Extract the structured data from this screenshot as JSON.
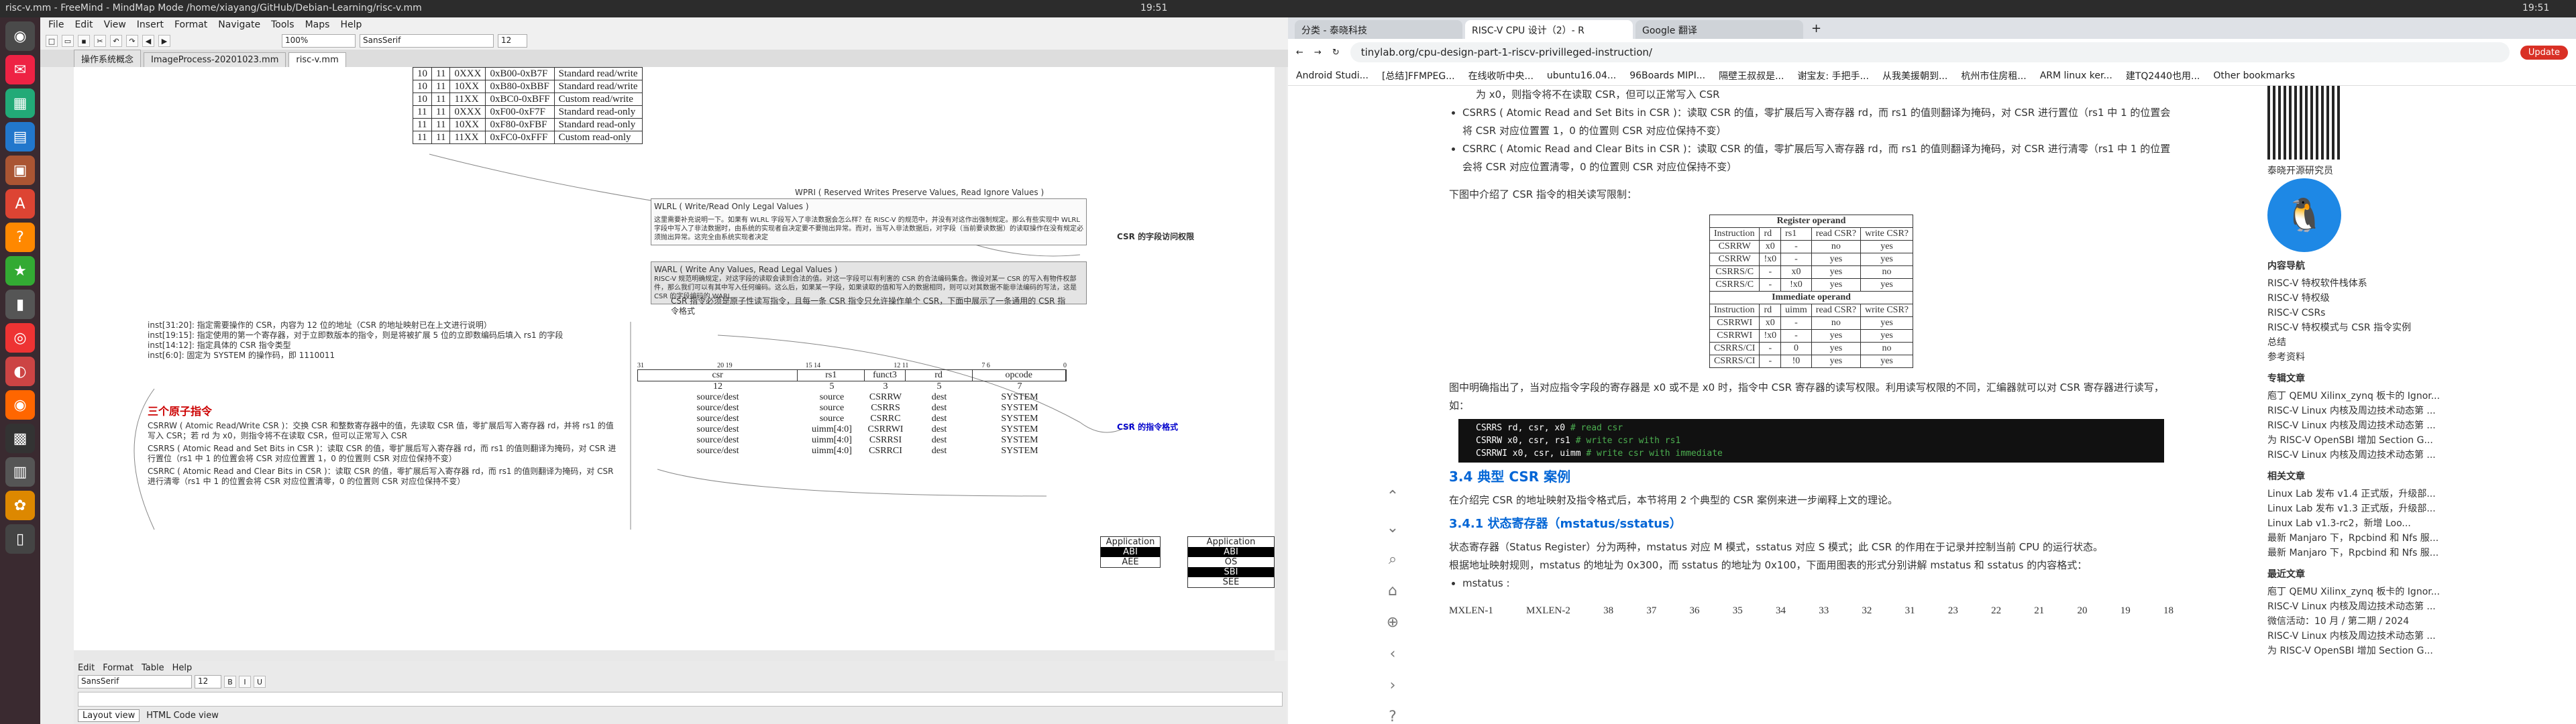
{
  "left_window": {
    "title": "risc-v.mm - FreeMind - MindMap Mode /home/xiayang/GitHub/Debian-Learning/risc-v.mm",
    "menu": [
      "File",
      "Edit",
      "View",
      "Insert",
      "Format",
      "Navigate",
      "Tools",
      "Maps",
      "Help"
    ],
    "zoom": "100%",
    "font": "SansSerif",
    "font_size": "12",
    "tabs": [
      "操作系统概念",
      "ImageProcess-20201023.mm",
      "risc-v.mm"
    ],
    "csr_addr_table": [
      [
        "10",
        "11",
        "0XXX",
        "0xB00-0xB7F",
        "Standard read/write"
      ],
      [
        "10",
        "11",
        "10XX",
        "0xB80-0xBBF",
        "Standard read/write"
      ],
      [
        "10",
        "11",
        "11XX",
        "0xBC0-0xBFF",
        "Custom read/write"
      ],
      [
        "11",
        "11",
        "0XXX",
        "0xF00-0xF7F",
        "Standard read-only"
      ],
      [
        "11",
        "11",
        "10XX",
        "0xF80-0xFBF",
        "Standard read-only"
      ],
      [
        "11",
        "11",
        "11XX",
        "0xFC0-0xFFF",
        "Custom read-only"
      ]
    ],
    "wpri": "WPRI ( Reserved Writes Preserve Values, Read Ignore Values )",
    "wlrl_title": "WLRL ( Write/Read Only Legal Values )",
    "wlrl_text": "这里需要补充说明一下。如果有 WLRL 字段写入了非法数据会怎么样？在 RISC-V 的规范中，并没有对这作出强制规定。那么有些实现中 WLRL 字段中写入了非法数据时，由系统的实现者自决定要不要抛出异常。而对，当写入非法数据后，对字段（当前要读数据）的读取操作在没有规定必须抛出异常。这完全由系统实现者决定",
    "warl_title": "WARL ( Write Any Values, Read Legal Values )",
    "warl_text": "RISC-V 规范明确规定，对这字段的读取会读到合法的值。对这一字段可以有利害的 CSR 的合法编码集合。微设对某一 CSR 的写入有物件权部件，那么我们可以有其中写入任何编码。这么后，如果某一字段，如果读取的值和写入的数据相同，则可以对其数据不能非法编码的写法，这是 CSR 的字段编码的 WARL",
    "csr_access_label": "CSR 的字段访问权限",
    "csr_intro": "CSR 指令必须是原子性读写指令，且每一条 CSR 指令只允许操作单个 CSR，下面中展示了一条通用的 CSR 指令格式",
    "inst_notes": [
      "inst[31:20]: 指定需要操作的 CSR，内容为 12 位的地址（CSR 的地址映射已在上文进行说明）",
      "inst[19:15]: 指定使用的第一个寄存器，对于立即数版本的指令，则是将被扩展 5 位的立即数编码后填入 rs1 的字段",
      "inst[14:12]: 指定具体的 CSR 指令类型",
      "inst[6:0]: 固定为 SYSTEM 的操作码，即 1110011"
    ],
    "fmt_bits": [
      "31",
      "20 19",
      "15 14",
      "12 11",
      "7 6",
      "0"
    ],
    "fmt_fields": [
      "csr",
      "rs1",
      "funct3",
      "rd",
      "opcode"
    ],
    "fmt_widths": [
      "12",
      "5",
      "3",
      "5",
      "7"
    ],
    "fmt_rows": [
      [
        "source/dest",
        "source",
        "CSRRW",
        "dest",
        "SYSTEM"
      ],
      [
        "source/dest",
        "source",
        "CSRRS",
        "dest",
        "SYSTEM"
      ],
      [
        "source/dest",
        "source",
        "CSRRC",
        "dest",
        "SYSTEM"
      ],
      [
        "source/dest",
        "uimm[4:0]",
        "CSRRWI",
        "dest",
        "SYSTEM"
      ],
      [
        "source/dest",
        "uimm[4:0]",
        "CSRRSI",
        "dest",
        "SYSTEM"
      ],
      [
        "source/dest",
        "uimm[4:0]",
        "CSRRCI",
        "dest",
        "SYSTEM"
      ]
    ],
    "fmt_label": "CSR 的指令格式",
    "three_title": "三个原子指令",
    "three_text": [
      "CSRRW ( Atomic Read/Write CSR )：交换 CSR 和整数寄存器中的值，先读取 CSR 值，零扩展后写入寄存器 rd，并将 rs1 的值写入 CSR；若 rd 为 x0，则指令将不在读取 CSR，但可以正常写入 CSR",
      "CSRRS ( Atomic Read and Set Bits in CSR )：读取 CSR 的值，零扩展后写入寄存器 rd，而 rs1 的值则翻译为掩码，对 CSR 进行置位（rs1 中 1 的位置会将 CSR 对应位置置 1，0 的位置则 CSR 对应位保持不变）",
      "CSRRC ( Atomic Read and Clear Bits in CSR )：读取 CSR 的值，零扩展后写入寄存器 rd，而 rs1 的值则翻译为掩码，对 CSR 进行清零（rs1 中 1 的位置会将 CSR 对应位置清零，0 的位置则 CSR 对应位保持不变）"
    ],
    "app_box": [
      "Application",
      "ABI",
      "AEE"
    ],
    "app_box2": [
      "Application",
      "ABI",
      "OS",
      "SBI",
      "SEE"
    ],
    "editor_menu": [
      "Edit",
      "Format",
      "Table",
      "Help"
    ],
    "editor_tabs": [
      "Layout view",
      "HTML Code view"
    ]
  },
  "right_window": {
    "clock": "19:51",
    "tabs": [
      "分类 - 泰晓科技",
      "RISC-V CPU 设计（2）- R",
      "Google 翻译"
    ],
    "url": "tinylab.org/cpu-design-part-1-riscv-privilleged-instruction/",
    "update": "Update",
    "bookmarks": [
      "Android Studi...",
      "[总结]FFMPEG...",
      "在线收听中央...",
      "ubuntu16.04...",
      "96Boards MIPI...",
      "隔壁王叔叔是...",
      "谢宝友: 手把手...",
      "从我美援朝到...",
      "杭州市住房租...",
      "ARM linux ker...",
      "建TQ2440也用...",
      "Other bookmarks"
    ],
    "p0": "为 x0，则指令将不在读取 CSR，但可以正常写入 CSR",
    "li_csrrs": "CSRRS ( Atomic Read and Set Bits in CSR )：读取 CSR 的值，零扩展后写入寄存器 rd，而 rs1 的值则翻译为掩码，对 CSR 进行置位（rs1 中 1 的位置会将 CSR 对应位置置 1，0 的位置则 CSR 对应位保持不变）",
    "li_csrrc": "CSRRC ( Atomic Read and Clear Bits in CSR )：读取 CSR 的值，零扩展后写入寄存器 rd，而 rs1 的值则翻译为掩码，对 CSR 进行清零（rs1 中 1 的位置会将 CSR 对应位置清零，0 的位置则 CSR 对应位保持不变）",
    "p_table_intro": "下图中介绍了 CSR 指令的相关读写限制：",
    "rw_head_reg": "Register operand",
    "rw_head_imm": "Immediate operand",
    "rw_cols": [
      "Instruction",
      "rd",
      "rs1",
      "read CSR?",
      "write CSR?"
    ],
    "rw_cols_imm": [
      "Instruction",
      "rd",
      "uimm",
      "read CSR?",
      "write CSR?"
    ],
    "rw_reg": [
      [
        "CSRRW",
        "x0",
        "-",
        "no",
        "yes"
      ],
      [
        "CSRRW",
        "!x0",
        "-",
        "yes",
        "yes"
      ],
      [
        "CSRRS/C",
        "-",
        "x0",
        "yes",
        "no"
      ],
      [
        "CSRRS/C",
        "-",
        "!x0",
        "yes",
        "yes"
      ]
    ],
    "rw_imm": [
      [
        "CSRRWI",
        "x0",
        "-",
        "no",
        "yes"
      ],
      [
        "CSRRWI",
        "!x0",
        "-",
        "yes",
        "yes"
      ],
      [
        "CSRRS/CI",
        "-",
        "0",
        "yes",
        "no"
      ],
      [
        "CSRRS/CI",
        "-",
        "!0",
        "yes",
        "yes"
      ]
    ],
    "p_after": "图中明确指出了，当对应指令字段的寄存器是 x0 或不是 x0 时，指令中 CSR 寄存器的读写权限。利用读写权限的不同，汇编器就可以对 CSR 寄存器进行读写，如：",
    "code": [
      {
        "c": "CSRRS rd, csr, x0",
        "m": "# read csr"
      },
      {
        "c": "CSRRW x0, csr, rs1",
        "m": "# write csr with rs1"
      },
      {
        "c": "CSRRWI x0, csr, uimm",
        "m": "# write csr with immediate"
      }
    ],
    "h34": "3.4 典型 CSR 案例",
    "p34": "在介绍完 CSR 的地址映射及指令格式后，本节将用 2 个典型的 CSR 案例来进一步阐释上文的理论。",
    "h341": "3.4.1 状态寄存器（mstatus/sstatus）",
    "p341a": "状态寄存器（Status Register）分为两种，mstatus 对应 M 模式，sstatus 对应 S 模式；此 CSR 的作用在于记录并控制当前 CPU 的运行状态。",
    "p341b": "根据地址映射规则，mstatus 的地址为 0x300，而 sstatus 的地址为 0x100，下面用图表的形式分别讲解 mstatus 和 sstatus 的内容格式：",
    "li_mstatus": "mstatus :",
    "mx_row": [
      "MXLEN-1",
      "MXLEN-2",
      "38",
      "37",
      "36",
      "35",
      "34",
      "33",
      "32",
      "31",
      "23",
      "22",
      "21",
      "20",
      "19",
      "18"
    ],
    "side": {
      "brand": "泰晓开源研究员",
      "toc_title": "内容导航",
      "toc": [
        "RISC-V 特权软件栈体系",
        "RISC-V 特权级",
        "RISC-V CSRs",
        "RISC-V 特权模式与 CSR 指令实例",
        "总结",
        "参考资料"
      ],
      "hot_title": "专辑文章",
      "hot": [
        "庖丁 QEMU Xilinx_zynq 板卡的 Ignor...",
        "RISC-V Linux 内核及周边技术动态第 ...",
        "RISC-V Linux 内核及周边技术动态第 ...",
        "为 RISC-V OpenSBI 增加 Section G...",
        "RISC-V Linux 内核及周边技术动态第 ..."
      ],
      "rel_title": "相关文章",
      "rel": [
        "Linux Lab 发布 v1.4 正式版，升级部...",
        "Linux Lab 发布 v1.3 正式版，升级部...",
        "Linux Lab v1.3-rc2，新增 Loo...",
        "最新 Manjaro 下，Rpcbind 和 Nfs 服...",
        "最新 Manjaro 下，Rpcbind 和 Nfs 服..."
      ],
      "new_title": "最近文章",
      "new": [
        "庖丁 QEMU Xilinx_zynq 板卡的 Ignor...",
        "RISC-V Linux 内核及周边技术动态第 ...",
        "微信活动：10 月 / 第二期 / 2024",
        "RISC-V Linux 内核及周边技术动态第 ...",
        "为 RISC-V OpenSBI 增加 Section G..."
      ]
    }
  }
}
